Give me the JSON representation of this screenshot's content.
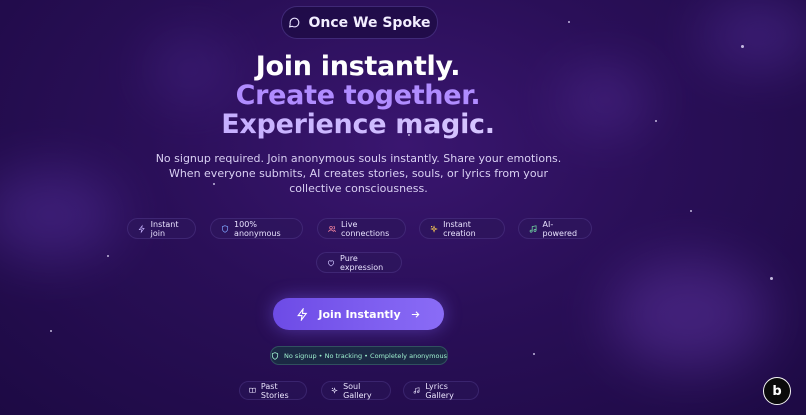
{
  "brand": {
    "name": "Once We Spoke",
    "icon": "chat-bubble-icon"
  },
  "hero": {
    "line1": "Join instantly.",
    "line2": "Create together.",
    "line3": "Experience magic.",
    "description": "No signup required. Join anonymous souls instantly. Share your emotions. When everyone submits, AI creates stories, souls, or lyrics from your collective consciousness."
  },
  "features": [
    {
      "label": "Instant join",
      "icon": "lightning-icon",
      "color": "#c7b4ff"
    },
    {
      "label": "100% anonymous",
      "icon": "shield-icon",
      "color": "#7fa6ff"
    },
    {
      "label": "Live connections",
      "icon": "users-icon",
      "color": "#ff8aa3"
    },
    {
      "label": "Instant creation",
      "icon": "sparkles-icon",
      "color": "#ffcf52"
    },
    {
      "label": "AI-powered",
      "icon": "music-icon",
      "color": "#74e3a6"
    },
    {
      "label": "Pure expression",
      "icon": "heart-icon",
      "color": "#cfc6ff"
    }
  ],
  "cta": {
    "label": "Join Instantly",
    "icon_left": "lightning-icon",
    "icon_right": "arrow-right-icon"
  },
  "privacy_note": "No signup • No tracking • Completely anonymous",
  "nav": [
    {
      "label": "Past Stories",
      "icon": "book-icon"
    },
    {
      "label": "Soul Gallery",
      "icon": "sparkles-icon"
    },
    {
      "label": "Lyrics Gallery",
      "icon": "music-icon"
    }
  ],
  "corner_badge": {
    "text": "b",
    "icon": "bolt-badge-icon"
  }
}
